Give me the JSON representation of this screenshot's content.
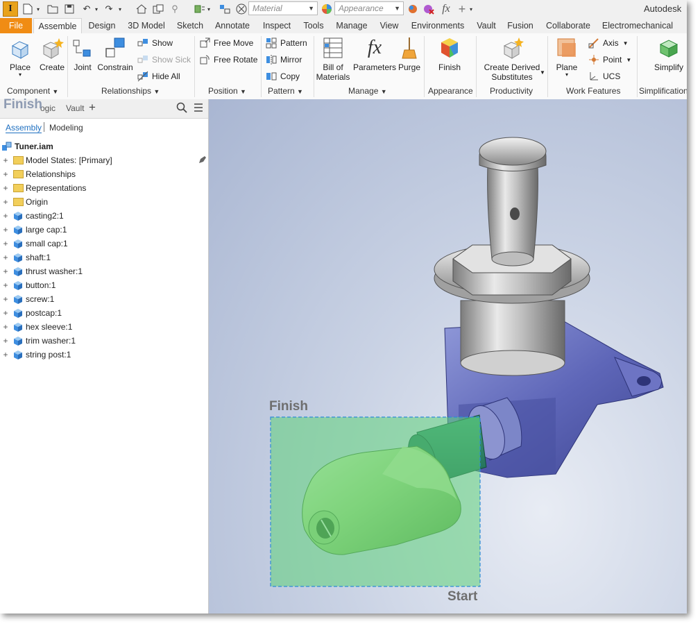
{
  "quick_access": {
    "material_placeholder": "Material",
    "appearance_placeholder": "Appearance",
    "app_title": "Autodesk"
  },
  "tabs": [
    {
      "label": "File"
    },
    {
      "label": "Assemble"
    },
    {
      "label": "Design"
    },
    {
      "label": "3D Model"
    },
    {
      "label": "Sketch"
    },
    {
      "label": "Annotate"
    },
    {
      "label": "Inspect"
    },
    {
      "label": "Tools"
    },
    {
      "label": "Manage"
    },
    {
      "label": "View"
    },
    {
      "label": "Environments"
    },
    {
      "label": "Vault"
    },
    {
      "label": "Fusion"
    },
    {
      "label": "Collaborate"
    },
    {
      "label": "Electromechanical"
    }
  ],
  "ribbon": {
    "component": {
      "place": "Place",
      "create": "Create",
      "label": "Component"
    },
    "relationships": {
      "joint": "Joint",
      "constrain": "Constrain",
      "show": "Show",
      "show_sick": "Show Sick",
      "hide_all": "Hide All",
      "label": "Relationships"
    },
    "position": {
      "free_move": "Free Move",
      "free_rotate": "Free Rotate",
      "label": "Position"
    },
    "pattern": {
      "pattern": "Pattern",
      "mirror": "Mirror",
      "copy": "Copy",
      "label": "Pattern"
    },
    "manage": {
      "bom_line1": "Bill of",
      "bom_line2": "Materials",
      "parameters": "Parameters",
      "purge": "Purge",
      "label": "Manage"
    },
    "appearance": {
      "finish": "Finish",
      "label": "Appearance"
    },
    "productivity": {
      "derived_line1": "Create Derived",
      "derived_line2": "Substitutes",
      "label": "Productivity"
    },
    "work_features": {
      "plane": "Plane",
      "axis": "Axis",
      "point": "Point",
      "ucs": "UCS",
      "label": "Work Features"
    },
    "simplification": {
      "simplify": "Simplify",
      "label": "Simplification"
    }
  },
  "browser": {
    "ghost_label": "Finish",
    "header_items": [
      "ogic",
      "Vault"
    ],
    "subtabs": {
      "assembly": "Assembly",
      "modeling": "Modeling"
    },
    "root": "Tuner.iam",
    "items": [
      {
        "label": "Model States: [Primary]",
        "kind": "folder"
      },
      {
        "label": "Relationships",
        "kind": "folder"
      },
      {
        "label": "Representations",
        "kind": "folder"
      },
      {
        "label": "Origin",
        "kind": "folder"
      },
      {
        "label": "casting2:1",
        "kind": "part"
      },
      {
        "label": "large cap:1",
        "kind": "part"
      },
      {
        "label": "small cap:1",
        "kind": "part"
      },
      {
        "label": "shaft:1",
        "kind": "part"
      },
      {
        "label": "thrust washer:1",
        "kind": "part"
      },
      {
        "label": "button:1",
        "kind": "part"
      },
      {
        "label": "screw:1",
        "kind": "part"
      },
      {
        "label": "postcap:1",
        "kind": "part"
      },
      {
        "label": "hex sleeve:1",
        "kind": "part"
      },
      {
        "label": "trim washer:1",
        "kind": "part"
      },
      {
        "label": "string post:1",
        "kind": "part"
      }
    ]
  },
  "viewport": {
    "finish_label": "Finish",
    "start_label": "Start",
    "selection_color": "#5fd27a"
  }
}
